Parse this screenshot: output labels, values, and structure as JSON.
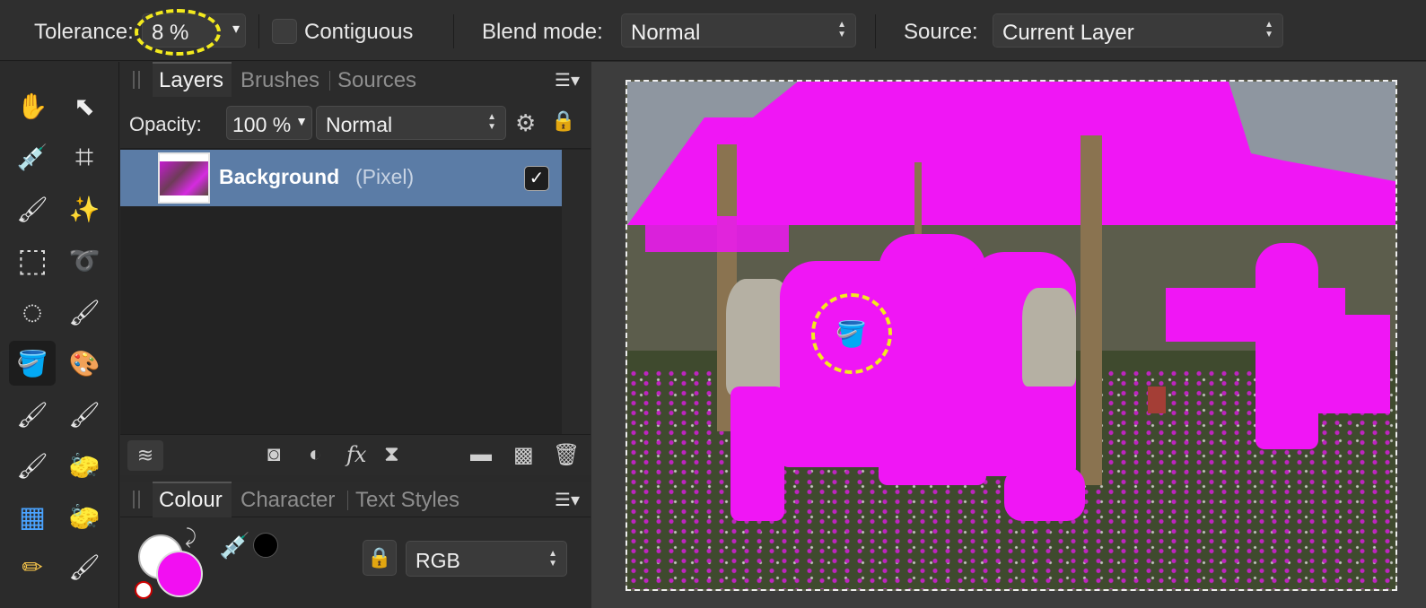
{
  "context_toolbar": {
    "tolerance_label": "Tolerance:",
    "tolerance_value": "8 %",
    "tolerance_dropdown_arrow": "▾",
    "contiguous_label": "Contiguous",
    "contiguous_checked": false,
    "blend_mode_label": "Blend mode:",
    "blend_mode_value": "Normal",
    "source_label": "Source:",
    "source_value": "Current Layer"
  },
  "tools": [
    {
      "name": "hand-tool",
      "icon": "hand-icon",
      "glyph": "✋"
    },
    {
      "name": "move-tool",
      "icon": "pointer-icon",
      "glyph": "⬉"
    },
    {
      "name": "color-picker-tool",
      "icon": "eyedropper-icon",
      "glyph": "💉"
    },
    {
      "name": "crop-tool",
      "icon": "crop-icon",
      "glyph": "⌗"
    },
    {
      "name": "selection-brush-tool",
      "icon": "selection-brush-icon",
      "glyph": "🖌"
    },
    {
      "name": "flood-select-tool",
      "icon": "magic-wand-icon",
      "glyph": "✨"
    },
    {
      "name": "rectangular-marquee-tool",
      "icon": "rectangle-marquee-icon",
      "glyph": "⬚"
    },
    {
      "name": "freehand-selection-tool",
      "icon": "lasso-icon",
      "glyph": "➰"
    },
    {
      "name": "elliptical-marquee-tool",
      "icon": "ellipse-marquee-icon",
      "glyph": "◌"
    },
    {
      "name": "paint-brush-tool",
      "icon": "paint-brush-icon",
      "glyph": "🖌"
    },
    {
      "name": "flood-fill-tool",
      "icon": "paint-bucket-icon",
      "glyph": "🪣"
    },
    {
      "name": "color-replacement-tool",
      "icon": "color-wheel-icon",
      "glyph": "🎨"
    },
    {
      "name": "pixel-tool",
      "icon": "pixel-brush-icon",
      "glyph": "🖌"
    },
    {
      "name": "mixer-brush-tool",
      "icon": "mixer-brush-icon",
      "glyph": "🖌"
    },
    {
      "name": "erase-brush-tool",
      "icon": "erase-brush-icon",
      "glyph": "🖌"
    },
    {
      "name": "background-erase-tool",
      "icon": "background-erase-icon",
      "glyph": "🧽"
    },
    {
      "name": "grid-tool",
      "icon": "grid-icon",
      "glyph": "▦"
    },
    {
      "name": "flood-erase-tool",
      "icon": "flood-erase-icon",
      "glyph": "🧽"
    },
    {
      "name": "eraser-tool",
      "icon": "eraser-icon",
      "glyph": "✏"
    },
    {
      "name": "clone-brush-tool",
      "icon": "clone-brush-icon",
      "glyph": "🖌"
    }
  ],
  "layers_panel": {
    "tabs": [
      "Layers",
      "Brushes",
      "Sources"
    ],
    "opacity_label": "Opacity:",
    "opacity_value": "100 %",
    "blend_value": "Normal",
    "layers": [
      {
        "name": "Background",
        "type": "(Pixel)",
        "visible": true
      }
    ]
  },
  "colour_panel": {
    "tabs": [
      "Colour",
      "Character",
      "Text Styles"
    ],
    "model": "RGB",
    "fill_color": "#ffffff",
    "stroke_color": "#f20ff2"
  },
  "colors": {
    "accent_selection": "#5b7ca6",
    "highlight_ring": "#f3ea1e",
    "fill_magenta": "#f016f5"
  }
}
